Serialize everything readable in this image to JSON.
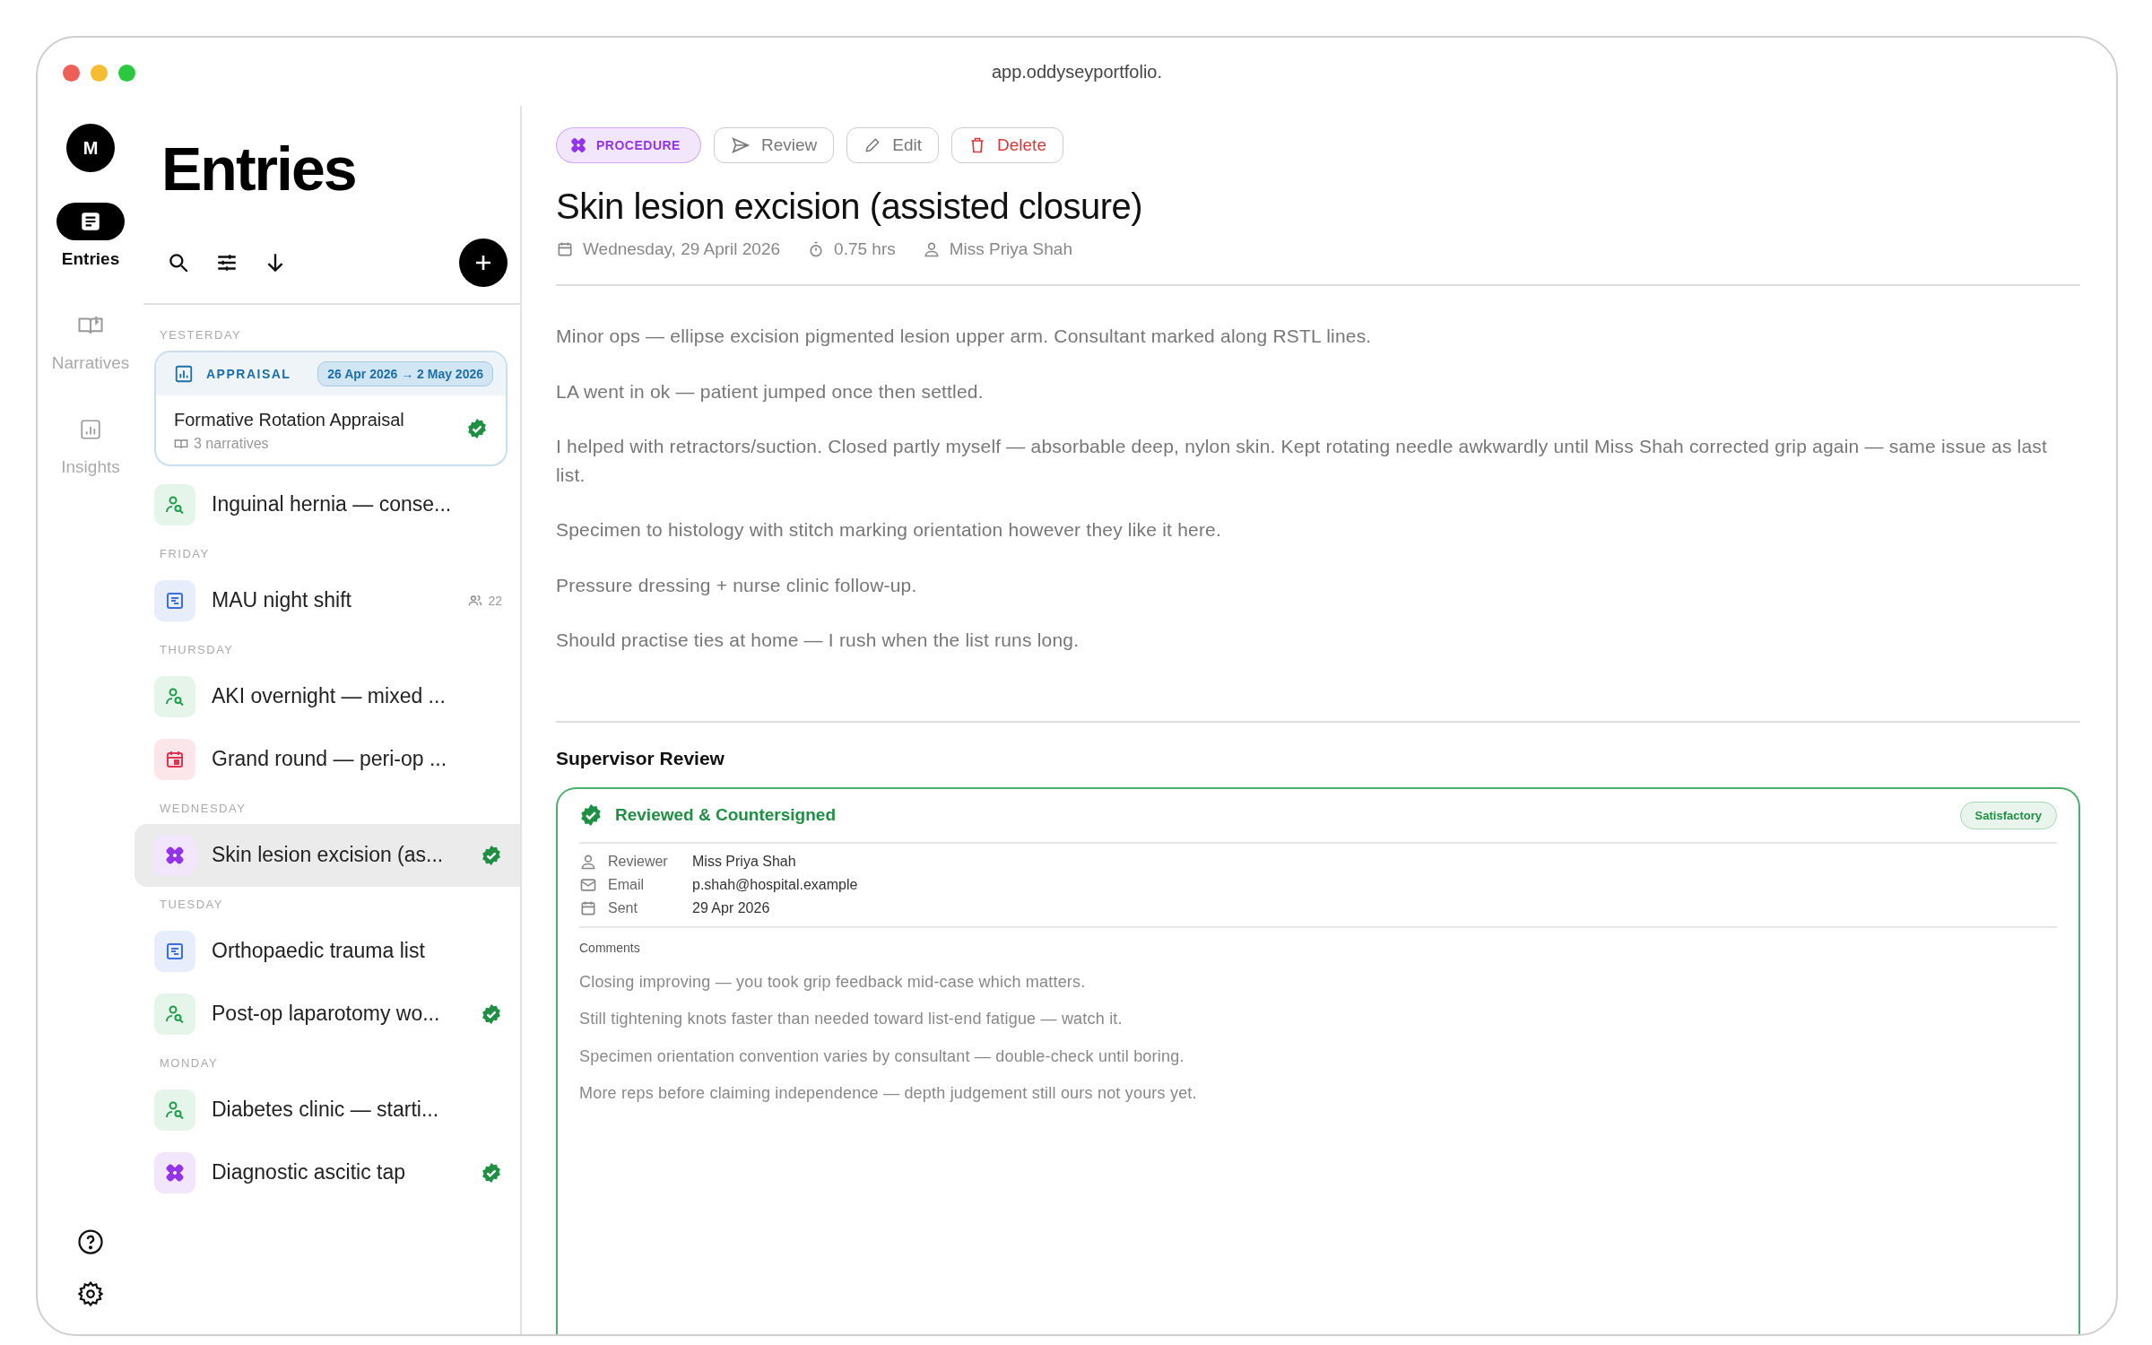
{
  "window": {
    "url": "app.oddyseyportfolio."
  },
  "rail": {
    "avatar": "M",
    "items": [
      {
        "kind": "entries",
        "label": "Entries",
        "selected": true
      },
      {
        "kind": "narratives",
        "label": "Narratives",
        "selected": false
      },
      {
        "kind": "insights",
        "label": "Insights",
        "selected": false
      }
    ]
  },
  "list": {
    "title": "Entries",
    "groups": [
      {
        "label": "YESTERDAY",
        "items": [
          {
            "kind": "appraisal",
            "tag": "APPRAISAL",
            "range": "26 Apr 2026 → 2 May 2026",
            "title": "Formative Rotation Appraisal",
            "meta": "3 narratives",
            "verified": true,
            "selected": false
          },
          {
            "kind": "case",
            "title": "Inguinal hernia — conse...",
            "verified": false,
            "selected": false
          }
        ]
      },
      {
        "label": "FRIDAY",
        "items": [
          {
            "kind": "shift",
            "title": "MAU night shift",
            "count": "22",
            "verified": false,
            "selected": false
          }
        ]
      },
      {
        "label": "THURSDAY",
        "items": [
          {
            "kind": "case",
            "title": "AKI overnight — mixed ...",
            "verified": false,
            "selected": false
          },
          {
            "kind": "teaching",
            "title": "Grand round — peri-op ...",
            "verified": false,
            "selected": false
          }
        ]
      },
      {
        "label": "WEDNESDAY",
        "items": [
          {
            "kind": "procedure",
            "title": "Skin lesion excision (as...",
            "verified": true,
            "selected": true
          }
        ]
      },
      {
        "label": "TUESDAY",
        "items": [
          {
            "kind": "shift",
            "title": "Orthopaedic trauma list",
            "verified": false,
            "selected": false
          },
          {
            "kind": "case",
            "title": "Post-op laparotomy wo...",
            "verified": true,
            "selected": false
          }
        ]
      },
      {
        "label": "MONDAY",
        "items": [
          {
            "kind": "case",
            "title": "Diabetes clinic — starti...",
            "verified": false,
            "selected": false
          },
          {
            "kind": "procedure",
            "title": "Diagnostic ascitic tap",
            "verified": true,
            "selected": false
          }
        ]
      }
    ]
  },
  "detail": {
    "tag": {
      "kind": "procedure",
      "label": "PROCEDURE"
    },
    "actions": [
      {
        "kind": "review",
        "label": "Review"
      },
      {
        "kind": "edit",
        "label": "Edit"
      },
      {
        "kind": "delete",
        "label": "Delete"
      }
    ],
    "title": "Skin lesion excision (assisted closure)",
    "meta": [
      {
        "kind": "date",
        "text": "Wednesday, 29 April 2026"
      },
      {
        "kind": "duration",
        "text": "0.75 hrs"
      },
      {
        "kind": "person",
        "text": "Miss Priya Shah"
      }
    ],
    "paragraphs": [
      "Minor ops — ellipse excision pigmented lesion upper arm. Consultant marked along RSTL lines.",
      "LA went in ok — patient jumped once then settled.",
      "I helped with retractors/suction. Closed partly myself — absorbable deep, nylon skin. Kept rotating needle awkwardly until Miss Shah corrected grip again — same issue as last list.",
      "Specimen to histology with stitch marking orientation however they like it here.",
      "Pressure dressing + nurse clinic follow-up.",
      "Should practise ties at home — I rush when the list runs long."
    ],
    "review": {
      "heading": "Supervisor Review",
      "status": "Reviewed & Countersigned",
      "rating": "Satisfactory",
      "fields": [
        {
          "kind": "person",
          "label": "Reviewer",
          "value": "Miss Priya Shah"
        },
        {
          "kind": "email",
          "label": "Email",
          "value": "p.shah@hospital.example"
        },
        {
          "kind": "date",
          "label": "Sent",
          "value": "29 Apr 2026"
        }
      ],
      "comments_label": "Comments",
      "comments": [
        "Closing improving — you took grip feedback mid-case which matters.",
        "Still tightening knots faster than needed toward list-end fatigue — watch it.",
        "Specimen orientation convention varies by consultant — double-check until boring.",
        "More reps before claiming independence — depth judgement still ours not yours yet."
      ]
    }
  }
}
